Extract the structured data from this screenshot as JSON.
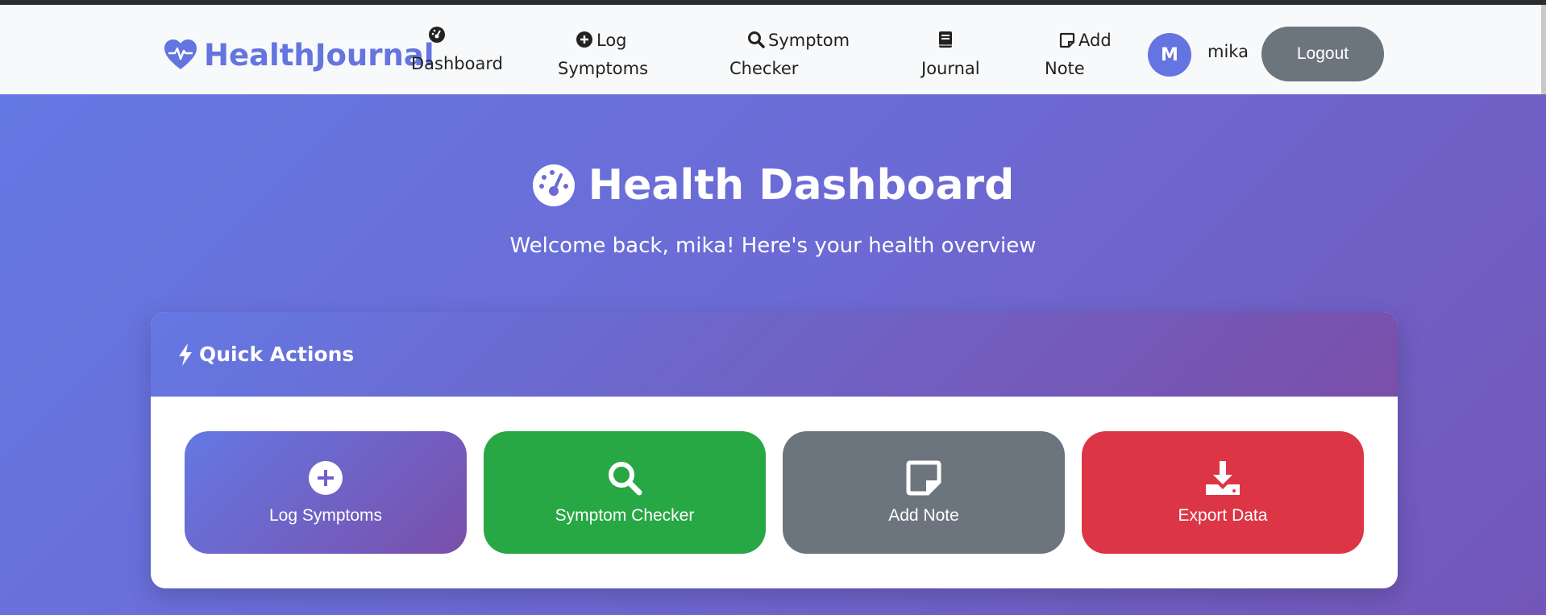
{
  "app": {
    "brand": "HealthJournal"
  },
  "nav": {
    "items": [
      {
        "line1": "",
        "line2": "Dashboard",
        "icon": "gauge-icon"
      },
      {
        "line1": "Log",
        "line2": "Symptoms",
        "icon": "plus-circle-icon"
      },
      {
        "line1": "Symptom",
        "line2": "Checker",
        "icon": "search-icon"
      },
      {
        "line1": "",
        "line2": "Journal",
        "icon": "book-icon"
      },
      {
        "line1": "Add",
        "line2": "Note",
        "icon": "note-icon"
      }
    ]
  },
  "user": {
    "avatar_initial": "M",
    "name": "mika",
    "logout_label": "Logout"
  },
  "header": {
    "title": "Health Dashboard",
    "subtitle": "Welcome back, mika! Here's your health overview"
  },
  "quick_actions": {
    "title": "Quick Actions",
    "items": [
      {
        "label": "Log Symptoms",
        "icon": "plus-circle-icon",
        "color": "#6f62cf"
      },
      {
        "label": "Symptom Checker",
        "icon": "search-icon",
        "color": "#28a745"
      },
      {
        "label": "Add Note",
        "icon": "note-icon",
        "color": "#6c757d"
      },
      {
        "label": "Export Data",
        "icon": "download-icon",
        "color": "#dc3545"
      }
    ]
  },
  "colors": {
    "brand": "#6474e0",
    "navbar": "#f8f9fa",
    "logout": "#6c757d"
  }
}
